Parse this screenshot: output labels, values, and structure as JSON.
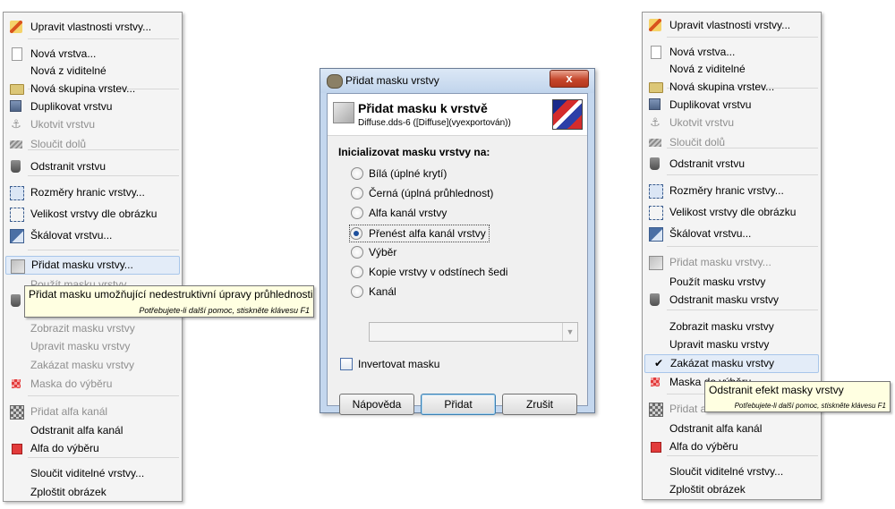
{
  "left_menu": {
    "items": [
      {
        "label": "Upravit vlastnosti vrstvy...",
        "icon": "pencil-icon",
        "state": "normal"
      },
      {
        "label": "Nová vrstva...",
        "icon": "new-layer-icon",
        "state": "normal"
      },
      {
        "label": "Nová z viditelné",
        "icon": "",
        "state": "normal"
      },
      {
        "label": "Nová skupina vrstev...",
        "icon": "folder-icon",
        "state": "normal"
      },
      {
        "label": "Duplikovat vrstvu",
        "icon": "duplicate-icon",
        "state": "normal"
      },
      {
        "label": "Ukotvit vrstvu",
        "icon": "anchor-icon",
        "state": "disabled"
      },
      {
        "label": "Sloučit dolů",
        "icon": "merge-down-icon",
        "state": "disabled"
      },
      {
        "label": "Odstranit vrstvu",
        "icon": "trash-icon",
        "state": "normal"
      },
      {
        "label": "Rozměry hranic vrstvy...",
        "icon": "layer-boundary-icon",
        "state": "normal"
      },
      {
        "label": "Velikost vrstvy dle obrázku",
        "icon": "layer-to-image-size-icon",
        "state": "normal"
      },
      {
        "label": "Škálovat vrstvu...",
        "icon": "scale-layer-icon",
        "state": "normal"
      },
      {
        "label": "Přidat masku vrstvy...",
        "icon": "add-mask-icon",
        "state": "highlighted"
      },
      {
        "label": "Použít masku vrstvy",
        "icon": "",
        "state": "disabled"
      },
      {
        "label": "Odstranit masku vrstvy",
        "icon": "trash-icon",
        "state": "disabled"
      },
      {
        "label": "Zobrazit masku vrstvy",
        "icon": "",
        "state": "disabled"
      },
      {
        "label": "Upravit masku vrstvy",
        "icon": "",
        "state": "disabled"
      },
      {
        "label": "Zakázat masku vrstvy",
        "icon": "",
        "state": "disabled"
      },
      {
        "label": "Maska do výběru",
        "icon": "mask-to-selection-icon",
        "state": "disabled"
      },
      {
        "label": "Přidat alfa kanál",
        "icon": "alpha-channel-icon",
        "state": "disabled"
      },
      {
        "label": "Odstranit alfa kanál",
        "icon": "",
        "state": "normal"
      },
      {
        "label": "Alfa do výběru",
        "icon": "alpha-to-selection-icon",
        "state": "normal"
      },
      {
        "label": "Sloučit viditelné vrstvy...",
        "icon": "",
        "state": "normal"
      },
      {
        "label": "Zploštit obrázek",
        "icon": "",
        "state": "normal"
      }
    ],
    "tooltip": {
      "text": "Přidat masku umožňující nedestruktivní úpravy průhlednosti",
      "help": "Potřebujete-li další pomoc, stiskněte klávesu F1"
    }
  },
  "dialog": {
    "window_title": "Přidat masku vrstvy",
    "close_label": "x",
    "header_title": "Přidat masku k vrstvě",
    "header_subtitle": "Diffuse.dds-6 ([Diffuse](vyexportován))",
    "section_label": "Inicializovat masku vrstvy na:",
    "options": [
      {
        "label": "Bílá (úplné krytí)",
        "checked": false
      },
      {
        "label": "Černá (úplná průhlednost)",
        "checked": false
      },
      {
        "label": "Alfa kanál vrstvy",
        "checked": false
      },
      {
        "label": "Přenést alfa kanál vrstvy",
        "checked": true
      },
      {
        "label": "Výběr",
        "checked": false
      },
      {
        "label": "Kopie vrstvy v odstínech šedi",
        "checked": false
      },
      {
        "label": "Kanál",
        "checked": false
      }
    ],
    "channel_combo_value": "",
    "invert_label": "Invertovat masku",
    "invert_checked": false,
    "buttons": {
      "help": "Nápověda",
      "add": "Přidat",
      "cancel": "Zrušit"
    }
  },
  "right_menu": {
    "items": [
      {
        "label": "Upravit vlastnosti vrstvy...",
        "icon": "pencil-icon",
        "state": "normal"
      },
      {
        "label": "Nová vrstva...",
        "icon": "new-layer-icon",
        "state": "normal"
      },
      {
        "label": "Nová z viditelné",
        "icon": "",
        "state": "normal"
      },
      {
        "label": "Nová skupina vrstev...",
        "icon": "folder-icon",
        "state": "normal"
      },
      {
        "label": "Duplikovat vrstvu",
        "icon": "duplicate-icon",
        "state": "normal"
      },
      {
        "label": "Ukotvit vrstvu",
        "icon": "anchor-icon",
        "state": "disabled"
      },
      {
        "label": "Sloučit dolů",
        "icon": "merge-down-icon",
        "state": "disabled"
      },
      {
        "label": "Odstranit vrstvu",
        "icon": "trash-icon",
        "state": "normal"
      },
      {
        "label": "Rozměry hranic vrstvy...",
        "icon": "layer-boundary-icon",
        "state": "normal"
      },
      {
        "label": "Velikost vrstvy dle obrázku",
        "icon": "layer-to-image-size-icon",
        "state": "normal"
      },
      {
        "label": "Škálovat vrstvu...",
        "icon": "scale-layer-icon",
        "state": "normal"
      },
      {
        "label": "Přidat masku vrstvy...",
        "icon": "add-mask-icon",
        "state": "disabled"
      },
      {
        "label": "Použít masku vrstvy",
        "icon": "",
        "state": "normal"
      },
      {
        "label": "Odstranit masku vrstvy",
        "icon": "trash-icon",
        "state": "normal"
      },
      {
        "label": "Zobrazit masku vrstvy",
        "icon": "",
        "state": "normal"
      },
      {
        "label": "Upravit masku vrstvy",
        "icon": "",
        "state": "normal"
      },
      {
        "label": "Zakázat masku vrstvy",
        "icon": "check-icon",
        "state": "highlighted"
      },
      {
        "label": "Maska do výběru",
        "icon": "mask-to-selection-icon",
        "state": "normal"
      },
      {
        "label": "Přidat alfa kanál",
        "icon": "alpha-channel-icon",
        "state": "disabled"
      },
      {
        "label": "Odstranit alfa kanál",
        "icon": "",
        "state": "normal"
      },
      {
        "label": "Alfa do výběru",
        "icon": "alpha-to-selection-icon",
        "state": "normal"
      },
      {
        "label": "Sloučit viditelné vrstvy...",
        "icon": "",
        "state": "normal"
      },
      {
        "label": "Zploštit obrázek",
        "icon": "",
        "state": "normal"
      }
    ],
    "tooltip": {
      "text": "Odstranit efekt masky vrstvy",
      "help": "Potřebujete-li další pomoc, stiskněte klávesu F1"
    }
  }
}
